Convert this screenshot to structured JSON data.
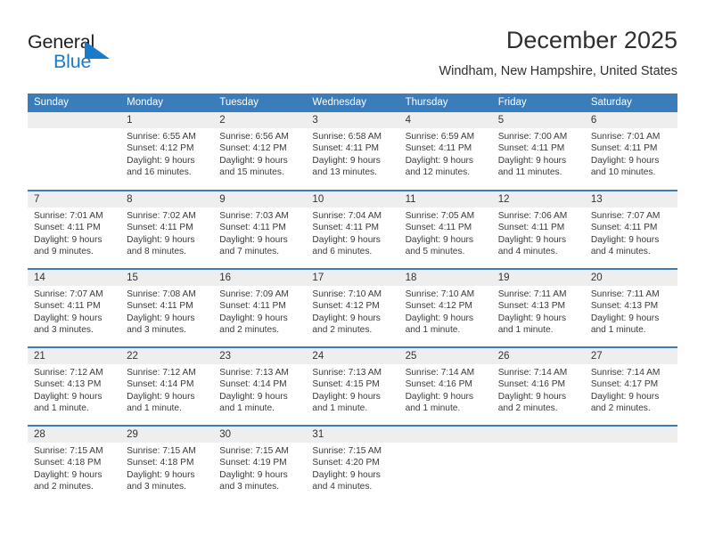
{
  "logo": {
    "word_top": "General",
    "word_bottom": "Blue",
    "triangle_icon": "triangle-icon",
    "color_blue": "#1b7ac7",
    "color_dark": "#231f20"
  },
  "header": {
    "title": "December 2025",
    "subtitle": "Windham, New Hampshire, United States"
  },
  "theme": {
    "header_bg": "#3b7cba",
    "header_text": "#ffffff",
    "daynum_bg": "#eeeeee",
    "row_divider": "#3b7cba",
    "body_text": "#3a3a3a"
  },
  "weekday_headers": [
    "Sunday",
    "Monday",
    "Tuesday",
    "Wednesday",
    "Thursday",
    "Friday",
    "Saturday"
  ],
  "weeks": [
    [
      {
        "day": "",
        "blank": true,
        "sunrise": "",
        "sunset": "",
        "daylight1": "",
        "daylight2": ""
      },
      {
        "day": "1",
        "sunrise": "Sunrise: 6:55 AM",
        "sunset": "Sunset: 4:12 PM",
        "daylight1": "Daylight: 9 hours",
        "daylight2": "and 16 minutes."
      },
      {
        "day": "2",
        "sunrise": "Sunrise: 6:56 AM",
        "sunset": "Sunset: 4:12 PM",
        "daylight1": "Daylight: 9 hours",
        "daylight2": "and 15 minutes."
      },
      {
        "day": "3",
        "sunrise": "Sunrise: 6:58 AM",
        "sunset": "Sunset: 4:11 PM",
        "daylight1": "Daylight: 9 hours",
        "daylight2": "and 13 minutes."
      },
      {
        "day": "4",
        "sunrise": "Sunrise: 6:59 AM",
        "sunset": "Sunset: 4:11 PM",
        "daylight1": "Daylight: 9 hours",
        "daylight2": "and 12 minutes."
      },
      {
        "day": "5",
        "sunrise": "Sunrise: 7:00 AM",
        "sunset": "Sunset: 4:11 PM",
        "daylight1": "Daylight: 9 hours",
        "daylight2": "and 11 minutes."
      },
      {
        "day": "6",
        "sunrise": "Sunrise: 7:01 AM",
        "sunset": "Sunset: 4:11 PM",
        "daylight1": "Daylight: 9 hours",
        "daylight2": "and 10 minutes."
      }
    ],
    [
      {
        "day": "7",
        "sunrise": "Sunrise: 7:01 AM",
        "sunset": "Sunset: 4:11 PM",
        "daylight1": "Daylight: 9 hours",
        "daylight2": "and 9 minutes."
      },
      {
        "day": "8",
        "sunrise": "Sunrise: 7:02 AM",
        "sunset": "Sunset: 4:11 PM",
        "daylight1": "Daylight: 9 hours",
        "daylight2": "and 8 minutes."
      },
      {
        "day": "9",
        "sunrise": "Sunrise: 7:03 AM",
        "sunset": "Sunset: 4:11 PM",
        "daylight1": "Daylight: 9 hours",
        "daylight2": "and 7 minutes."
      },
      {
        "day": "10",
        "sunrise": "Sunrise: 7:04 AM",
        "sunset": "Sunset: 4:11 PM",
        "daylight1": "Daylight: 9 hours",
        "daylight2": "and 6 minutes."
      },
      {
        "day": "11",
        "sunrise": "Sunrise: 7:05 AM",
        "sunset": "Sunset: 4:11 PM",
        "daylight1": "Daylight: 9 hours",
        "daylight2": "and 5 minutes."
      },
      {
        "day": "12",
        "sunrise": "Sunrise: 7:06 AM",
        "sunset": "Sunset: 4:11 PM",
        "daylight1": "Daylight: 9 hours",
        "daylight2": "and 4 minutes."
      },
      {
        "day": "13",
        "sunrise": "Sunrise: 7:07 AM",
        "sunset": "Sunset: 4:11 PM",
        "daylight1": "Daylight: 9 hours",
        "daylight2": "and 4 minutes."
      }
    ],
    [
      {
        "day": "14",
        "sunrise": "Sunrise: 7:07 AM",
        "sunset": "Sunset: 4:11 PM",
        "daylight1": "Daylight: 9 hours",
        "daylight2": "and 3 minutes."
      },
      {
        "day": "15",
        "sunrise": "Sunrise: 7:08 AM",
        "sunset": "Sunset: 4:11 PM",
        "daylight1": "Daylight: 9 hours",
        "daylight2": "and 3 minutes."
      },
      {
        "day": "16",
        "sunrise": "Sunrise: 7:09 AM",
        "sunset": "Sunset: 4:11 PM",
        "daylight1": "Daylight: 9 hours",
        "daylight2": "and 2 minutes."
      },
      {
        "day": "17",
        "sunrise": "Sunrise: 7:10 AM",
        "sunset": "Sunset: 4:12 PM",
        "daylight1": "Daylight: 9 hours",
        "daylight2": "and 2 minutes."
      },
      {
        "day": "18",
        "sunrise": "Sunrise: 7:10 AM",
        "sunset": "Sunset: 4:12 PM",
        "daylight1": "Daylight: 9 hours",
        "daylight2": "and 1 minute."
      },
      {
        "day": "19",
        "sunrise": "Sunrise: 7:11 AM",
        "sunset": "Sunset: 4:13 PM",
        "daylight1": "Daylight: 9 hours",
        "daylight2": "and 1 minute."
      },
      {
        "day": "20",
        "sunrise": "Sunrise: 7:11 AM",
        "sunset": "Sunset: 4:13 PM",
        "daylight1": "Daylight: 9 hours",
        "daylight2": "and 1 minute."
      }
    ],
    [
      {
        "day": "21",
        "sunrise": "Sunrise: 7:12 AM",
        "sunset": "Sunset: 4:13 PM",
        "daylight1": "Daylight: 9 hours",
        "daylight2": "and 1 minute."
      },
      {
        "day": "22",
        "sunrise": "Sunrise: 7:12 AM",
        "sunset": "Sunset: 4:14 PM",
        "daylight1": "Daylight: 9 hours",
        "daylight2": "and 1 minute."
      },
      {
        "day": "23",
        "sunrise": "Sunrise: 7:13 AM",
        "sunset": "Sunset: 4:14 PM",
        "daylight1": "Daylight: 9 hours",
        "daylight2": "and 1 minute."
      },
      {
        "day": "24",
        "sunrise": "Sunrise: 7:13 AM",
        "sunset": "Sunset: 4:15 PM",
        "daylight1": "Daylight: 9 hours",
        "daylight2": "and 1 minute."
      },
      {
        "day": "25",
        "sunrise": "Sunrise: 7:14 AM",
        "sunset": "Sunset: 4:16 PM",
        "daylight1": "Daylight: 9 hours",
        "daylight2": "and 1 minute."
      },
      {
        "day": "26",
        "sunrise": "Sunrise: 7:14 AM",
        "sunset": "Sunset: 4:16 PM",
        "daylight1": "Daylight: 9 hours",
        "daylight2": "and 2 minutes."
      },
      {
        "day": "27",
        "sunrise": "Sunrise: 7:14 AM",
        "sunset": "Sunset: 4:17 PM",
        "daylight1": "Daylight: 9 hours",
        "daylight2": "and 2 minutes."
      }
    ],
    [
      {
        "day": "28",
        "sunrise": "Sunrise: 7:15 AM",
        "sunset": "Sunset: 4:18 PM",
        "daylight1": "Daylight: 9 hours",
        "daylight2": "and 2 minutes."
      },
      {
        "day": "29",
        "sunrise": "Sunrise: 7:15 AM",
        "sunset": "Sunset: 4:18 PM",
        "daylight1": "Daylight: 9 hours",
        "daylight2": "and 3 minutes."
      },
      {
        "day": "30",
        "sunrise": "Sunrise: 7:15 AM",
        "sunset": "Sunset: 4:19 PM",
        "daylight1": "Daylight: 9 hours",
        "daylight2": "and 3 minutes."
      },
      {
        "day": "31",
        "sunrise": "Sunrise: 7:15 AM",
        "sunset": "Sunset: 4:20 PM",
        "daylight1": "Daylight: 9 hours",
        "daylight2": "and 4 minutes."
      },
      {
        "day": "",
        "blank": true,
        "sunrise": "",
        "sunset": "",
        "daylight1": "",
        "daylight2": ""
      },
      {
        "day": "",
        "blank": true,
        "sunrise": "",
        "sunset": "",
        "daylight1": "",
        "daylight2": ""
      },
      {
        "day": "",
        "blank": true,
        "sunrise": "",
        "sunset": "",
        "daylight1": "",
        "daylight2": ""
      }
    ]
  ]
}
